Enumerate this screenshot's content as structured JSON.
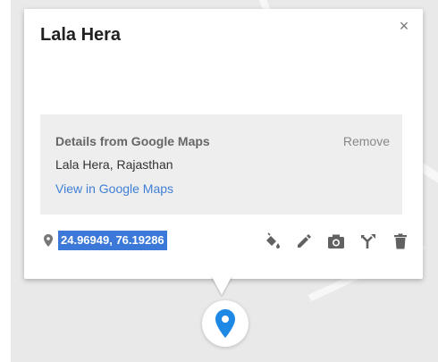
{
  "place": {
    "title": "Lala Hera",
    "coordinates": "24.96949, 76.19286"
  },
  "details": {
    "heading": "Details from Google Maps",
    "remove_label": "Remove",
    "address": "Lala Hera, Rajasthan",
    "view_link": "View in Google Maps"
  },
  "buttons": {
    "close": "×"
  },
  "icons": {
    "coordinate_pin": "map-pin-small-icon",
    "style": "paint-bucket-icon",
    "edit": "pencil-icon",
    "photo": "camera-icon",
    "directions": "directions-fork-icon",
    "delete": "trash-icon",
    "marker": "map-marker-icon"
  },
  "colors": {
    "marker_blue": "#1e88e5",
    "selection_blue": "#3c78d8",
    "link_blue": "#3f7fd6",
    "map_bg": "#e9e9e9"
  }
}
